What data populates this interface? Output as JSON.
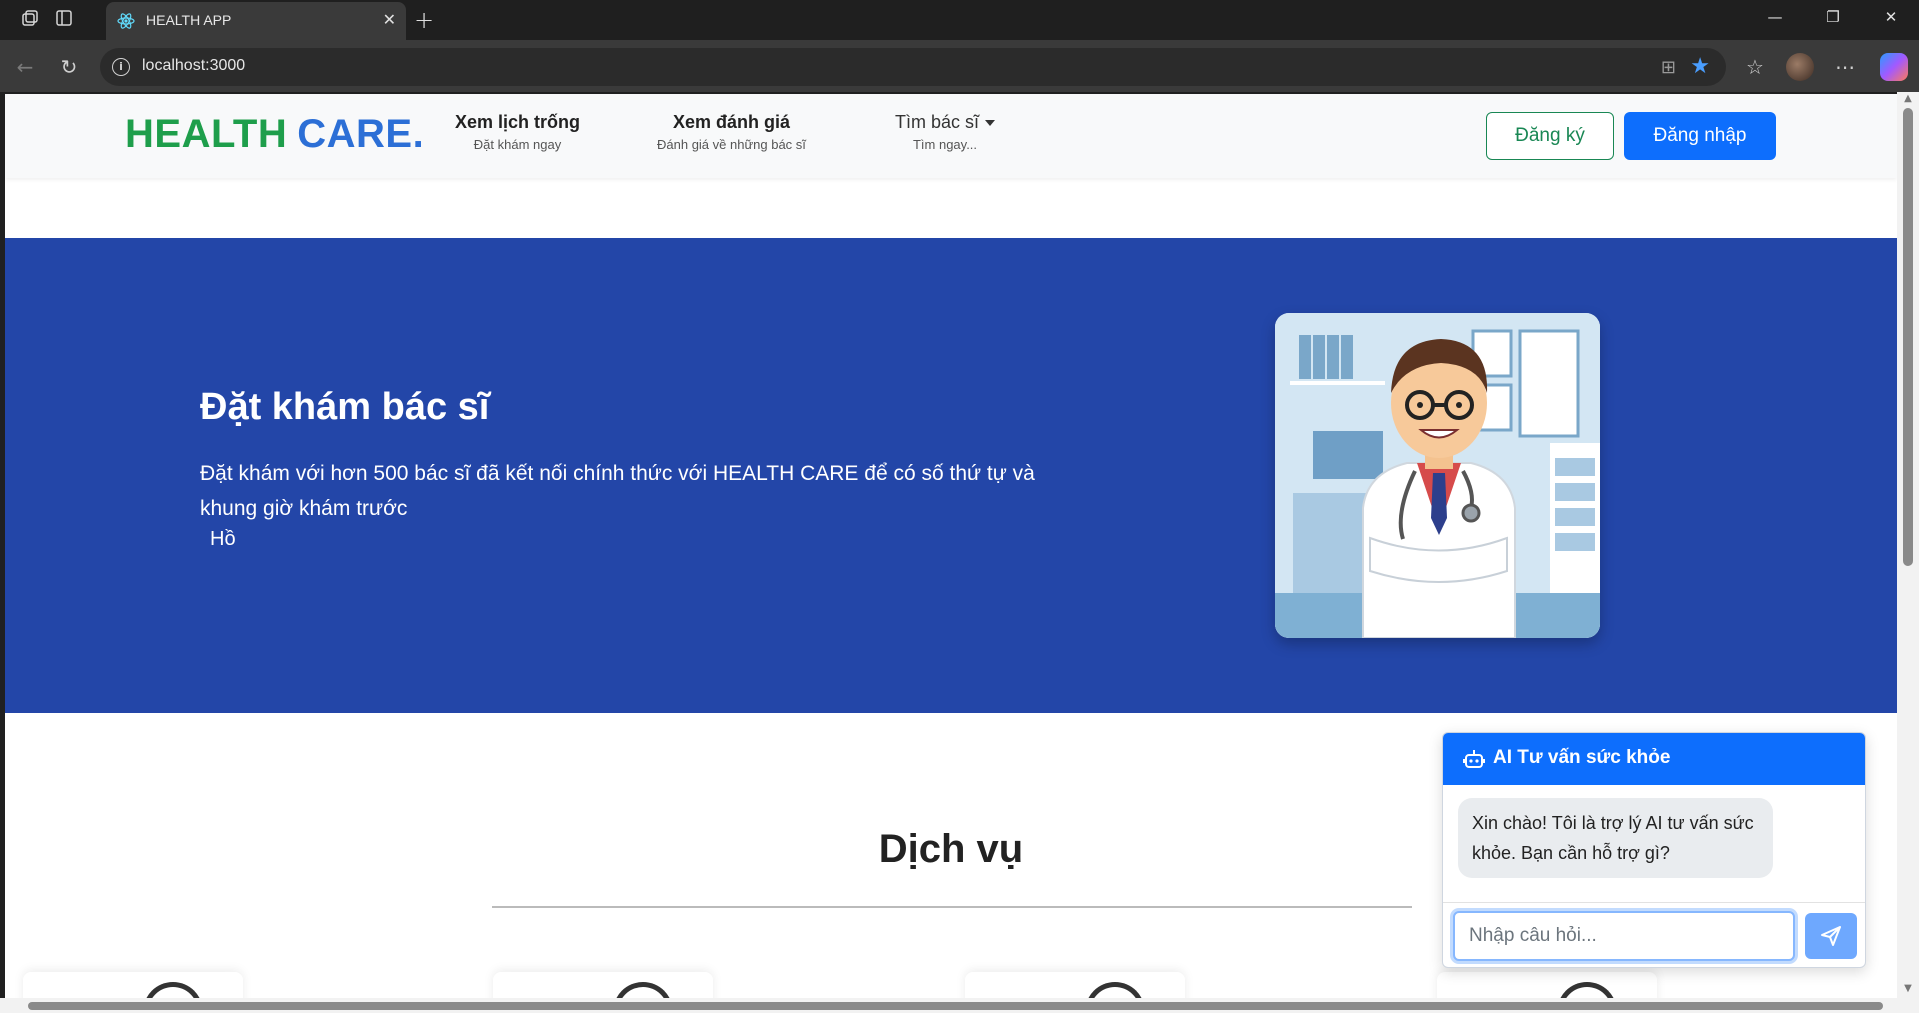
{
  "browser": {
    "tab_title": "HEALTH APP",
    "url": "localhost:3000"
  },
  "header": {
    "logo_part1": "HEALTH",
    "logo_part2": "CARE.",
    "menu": [
      {
        "title": "Xem lịch trống",
        "subtitle": "Đặt khám ngay"
      },
      {
        "title": "Xem đánh giá",
        "subtitle": "Đánh giá về những bác sĩ"
      },
      {
        "title": "Tìm bác sĩ",
        "subtitle": "Tìm ngay..."
      }
    ],
    "register_label": "Đăng ký",
    "login_label": "Đăng nhập"
  },
  "hero": {
    "title": "Đặt khám bác sĩ",
    "text": "Đặt khám với hơn 500 bác sĩ đã kết nối chính thức với HEALTH CARE để có số thứ tự và khung giờ khám trước",
    "garbled": "Hồ"
  },
  "services": {
    "title": "Dịch vụ"
  },
  "chat": {
    "title": "AI Tư vấn sức khỏe",
    "greeting": "Xin chào! Tôi là trợ lý AI tư vấn sức khỏe. Bạn cần hỗ trợ gì?",
    "input_placeholder": "Nhập câu hỏi..."
  },
  "colors": {
    "logo_green": "#1e9e4b",
    "logo_blue": "#2c6fd6",
    "hero_bg": "#2346a8",
    "primary": "#0d6efd",
    "success": "#198754"
  },
  "icons": [
    "workspaces-icon",
    "tab-sidebar-icon",
    "react-favicon-icon",
    "close-tab-icon",
    "new-tab-icon",
    "minimize-icon",
    "restore-icon",
    "close-window-icon",
    "back-icon",
    "reload-icon",
    "site-info-icon",
    "app-available-icon",
    "favorite-star-icon",
    "favorites-icon",
    "profile-avatar",
    "more-icon",
    "copilot-icon",
    "caret-down-icon",
    "robot-icon",
    "send-icon"
  ]
}
